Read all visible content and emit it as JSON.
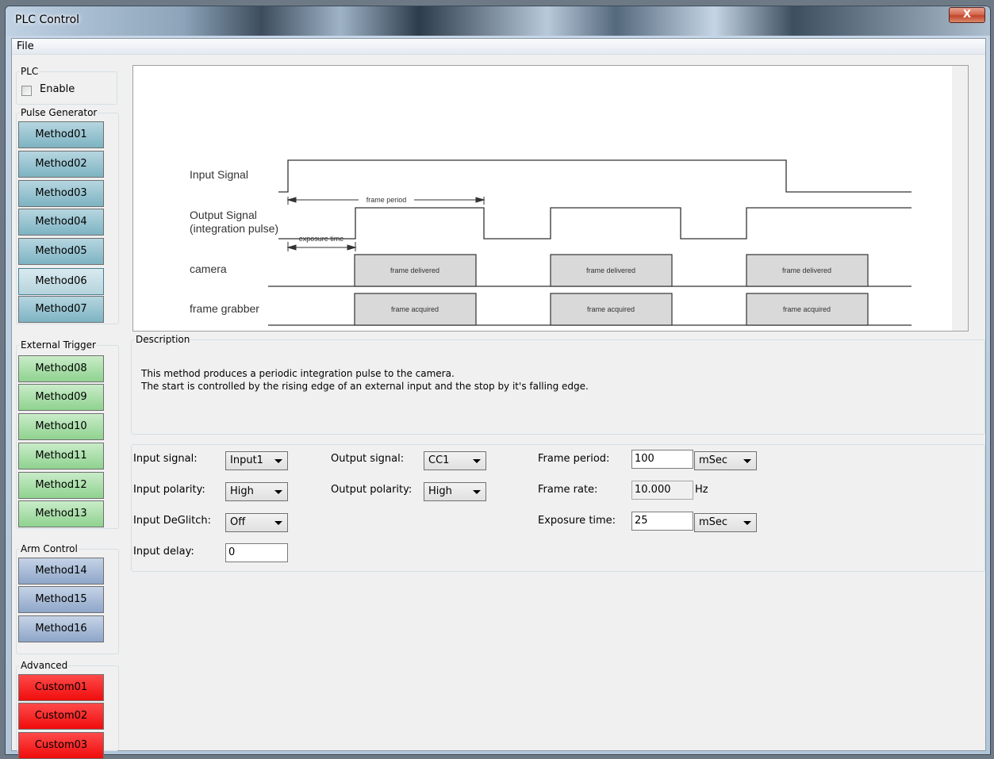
{
  "window": {
    "title": "PLC Control",
    "close_label": "X"
  },
  "menu": {
    "file": "File"
  },
  "plc": {
    "group_label": "PLC",
    "enable_label": "Enable",
    "enable_checked": false
  },
  "pulse_generator": {
    "group_label": "Pulse Generator",
    "methods": [
      "Method01",
      "Method02",
      "Method03",
      "Method04",
      "Method05",
      "Method06",
      "Method07"
    ],
    "selected": "Method06"
  },
  "external_trigger": {
    "group_label": "External Trigger",
    "methods": [
      "Method08",
      "Method09",
      "Method10",
      "Method11",
      "Method12",
      "Method13"
    ]
  },
  "arm_control": {
    "group_label": "Arm Control",
    "methods": [
      "Method14",
      "Method15",
      "Method16"
    ]
  },
  "advanced": {
    "group_label": "Advanced",
    "customs": [
      "Custom01",
      "Custom02",
      "Custom03"
    ]
  },
  "diagram": {
    "input_signal": "Input Signal",
    "output_signal_line1": "Output Signal",
    "output_signal_line2": "(integration pulse)",
    "camera": "camera",
    "frame_grabber": "frame grabber",
    "frame_period": "frame period",
    "exposure_time": "exposure time",
    "frame_delivered": "frame delivered",
    "frame_acquired": "frame acquired"
  },
  "description": {
    "group_label": "Description",
    "line1": "This method produces a periodic integration pulse to the camera.",
    "line2": "The start is controlled by the rising edge of an external input and the stop by it's falling edge."
  },
  "settings": {
    "input_signal_label": "Input signal:",
    "input_signal_value": "Input1",
    "input_polarity_label": "Input polarity:",
    "input_polarity_value": "High",
    "input_deglitch_label": "Input DeGlitch:",
    "input_deglitch_value": "Off",
    "input_delay_label": "Input delay:",
    "input_delay_value": "0",
    "output_signal_label": "Output signal:",
    "output_signal_value": "CC1",
    "output_polarity_label": "Output polarity:",
    "output_polarity_value": "High",
    "frame_period_label": "Frame period:",
    "frame_period_value": "100",
    "frame_period_unit": "mSec",
    "frame_rate_label": "Frame rate:",
    "frame_rate_value": "10.000",
    "frame_rate_unit": "Hz",
    "exposure_time_label": "Exposure time:",
    "exposure_time_value": "25",
    "exposure_time_unit": "mSec"
  }
}
